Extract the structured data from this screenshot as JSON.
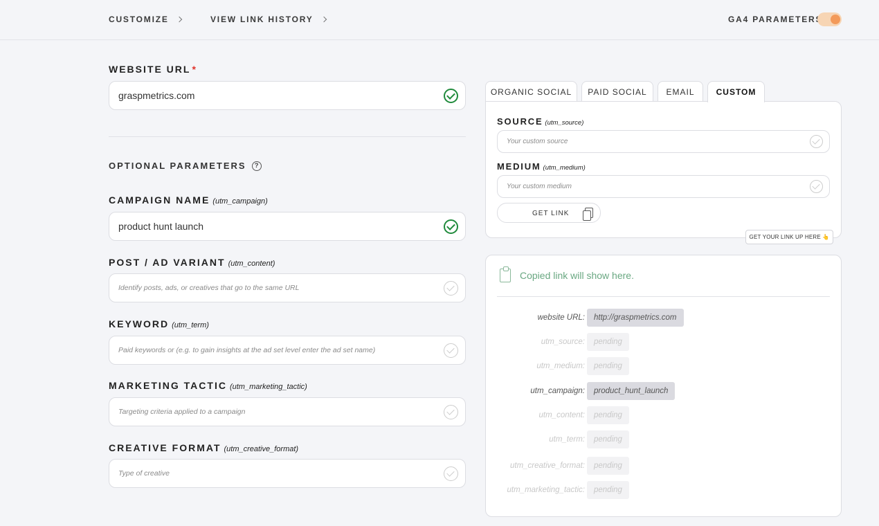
{
  "nav": {
    "customize": "CUSTOMIZE",
    "history": "VIEW LINK HISTORY",
    "ga4_label": "GA4 PARAMETERS",
    "ga4_enabled": true
  },
  "website": {
    "label": "WEBSITE URL",
    "required_mark": "*",
    "value": "graspmetrics.com"
  },
  "optional": {
    "heading": "OPTIONAL PARAMETERS",
    "help": "?"
  },
  "fields": {
    "campaign": {
      "label": "CAMPAIGN NAME",
      "param": "(utm_campaign)",
      "value": "product hunt launch"
    },
    "content": {
      "label": "POST / AD VARIANT",
      "param": "(utm_content)",
      "placeholder": "Identify posts, ads, or creatives that go to the same URL"
    },
    "term": {
      "label": "KEYWORD",
      "param": "(utm_term)",
      "placeholder": "Paid keywords or (e.g. to gain insights at the ad set level enter the ad set name)"
    },
    "tactic": {
      "label": "MARKETING TACTIC",
      "param": "(utm_marketing_tactic)",
      "placeholder": "Targeting criteria applied to a campaign"
    },
    "format": {
      "label": "CREATIVE FORMAT",
      "param": "(utm_creative_format)",
      "placeholder": "Type of creative"
    }
  },
  "tabs": {
    "organic": "ORGANIC SOCIAL",
    "paid": "PAID SOCIAL",
    "email": "EMAIL",
    "custom": "CUSTOM",
    "active": "CUSTOM"
  },
  "custom_panel": {
    "source_label": "SOURCE",
    "source_param": "(utm_source)",
    "source_placeholder": "Your custom source",
    "medium_label": "MEDIUM",
    "medium_param": "(utm_medium)",
    "medium_placeholder": "Your custom medium",
    "get_link": "GET LINK",
    "hint": "GET YOUR LINK UP HERE 👆"
  },
  "result": {
    "copied_text": "Copied link will show here.",
    "rows": [
      {
        "key": "website URL:",
        "value": "http://graspmetrics.com",
        "set": true
      },
      {
        "key": "utm_source:",
        "value": "pending",
        "set": false
      },
      {
        "key": "utm_medium:",
        "value": "pending",
        "set": false
      },
      {
        "key": "utm_campaign:",
        "value": "product_hunt_launch",
        "set": true
      },
      {
        "key": "utm_content:",
        "value": "pending",
        "set": false
      },
      {
        "key": "utm_term:",
        "value": "pending",
        "set": false
      },
      {
        "key": "utm_creative_format:",
        "value": "pending",
        "set": false
      },
      {
        "key": "utm_marketing_tactic:",
        "value": "pending",
        "set": false
      }
    ]
  },
  "colors": {
    "valid_check": "#1f8a3b",
    "required": "#e0332c",
    "toggle_on": "#f39a5a",
    "copied_green": "#6aa882"
  }
}
